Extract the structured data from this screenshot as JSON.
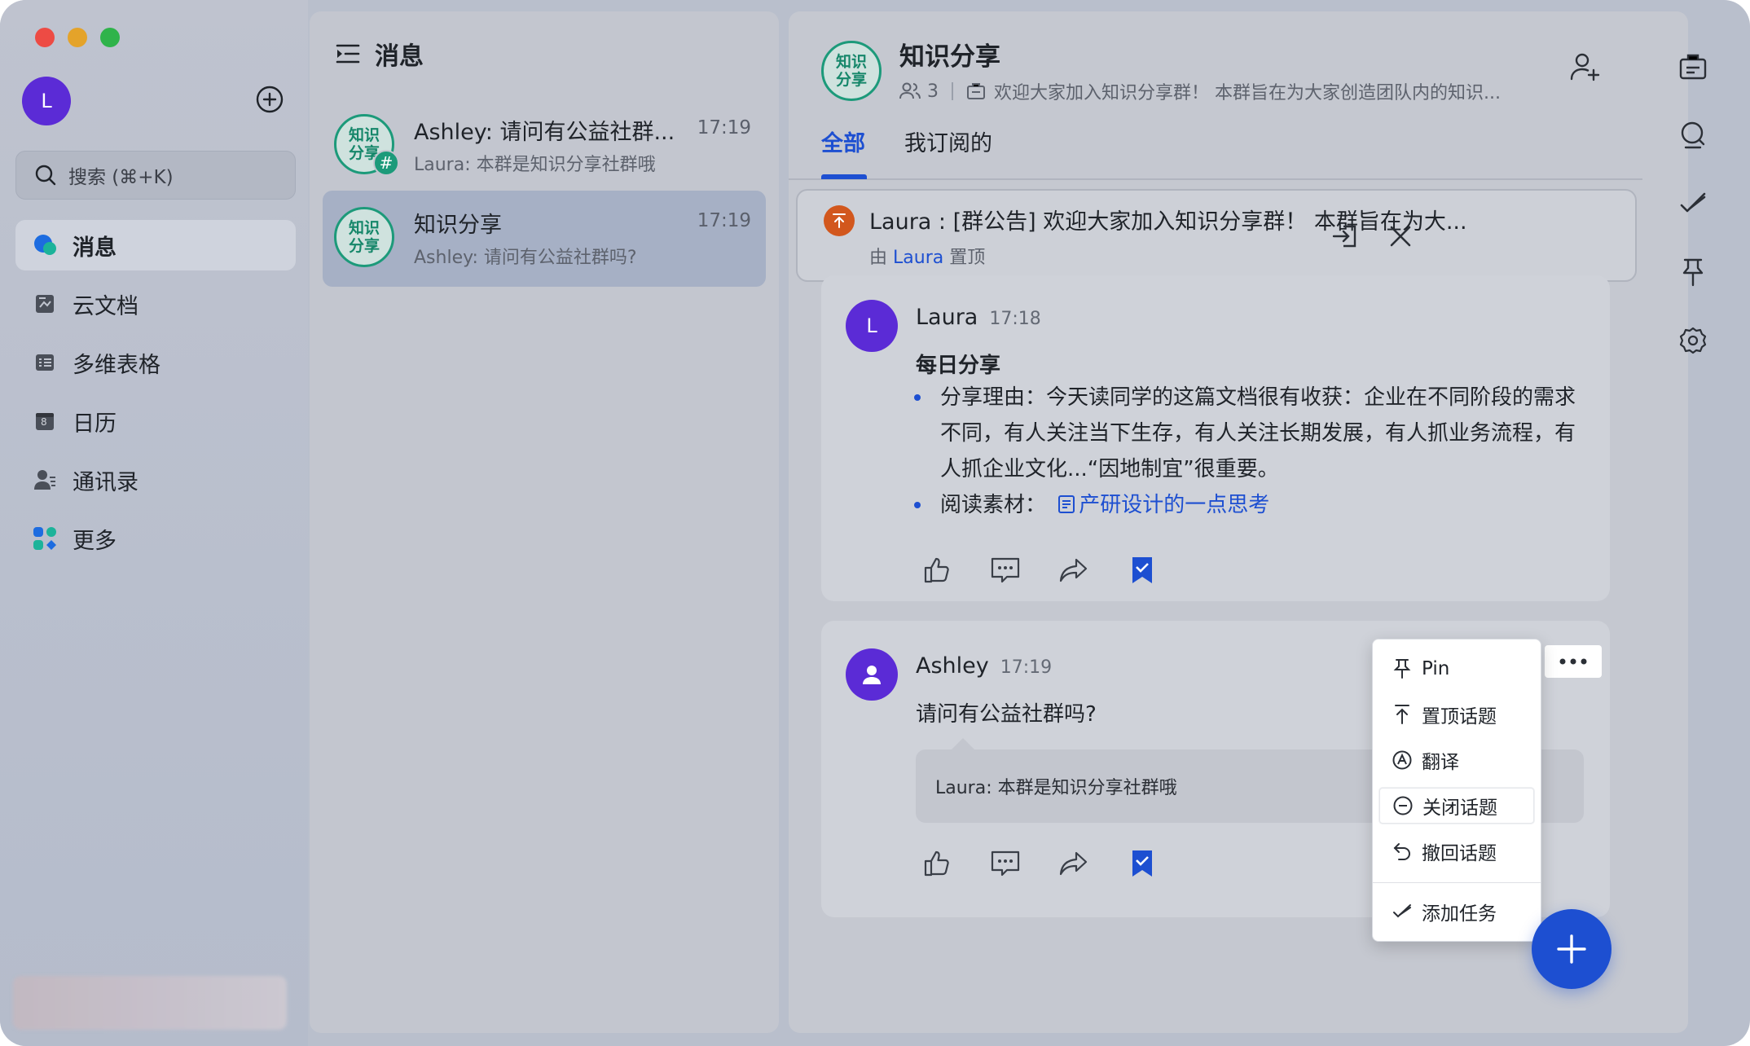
{
  "sidebar": {
    "avatar_letter": "L",
    "search_placeholder": "搜索 (⌘+K)",
    "items": [
      {
        "label": "消息",
        "icon": "chat-bubble-icon"
      },
      {
        "label": "云文档",
        "icon": "doc-icon"
      },
      {
        "label": "多维表格",
        "icon": "table-icon"
      },
      {
        "label": "日历",
        "icon": "calendar-icon"
      },
      {
        "label": "通讯录",
        "icon": "contacts-icon"
      },
      {
        "label": "更多",
        "icon": "apps-icon"
      }
    ],
    "calendar_day": "8"
  },
  "message_list": {
    "title": "消息",
    "chats": [
      {
        "name": "Ashley: 请问有公益社群...",
        "time": "17:19",
        "preview": "Laura: 本群是知识分享社群哦",
        "avatar_text": "知识\n分享",
        "badge": "#"
      },
      {
        "name": "知识分享",
        "time": "17:19",
        "preview": "Ashley: 请问有公益社群吗?",
        "avatar_text": "知识\n分享"
      }
    ]
  },
  "chat": {
    "avatar_text": "知识\n分享",
    "title": "知识分享",
    "member_count": "3",
    "description": "欢迎大家加入知识分享群！ 本群旨在为大家创造团队内的知识...",
    "tabs": [
      "全部",
      "我订阅的"
    ],
    "pinned": {
      "text": "Laura : [群公告] 欢迎大家加入知识分享群！ 本群旨在为大...",
      "by_prefix": "由",
      "by_name": "Laura",
      "by_suffix": "置顶"
    },
    "messages": [
      {
        "avatar_letter": "L",
        "sender": "Laura",
        "time": "17:18",
        "title": "每日分享",
        "bullet1": "分享理由：今天读同学的这篇文档很有收获：企业在不同阶段的需求不同，有人关注当下生存，有人关注长期发展，有人抓业务流程，有人抓企业文化...“因地制宜”很重要。",
        "bullet2_label": "阅读素材：",
        "bullet2_link": "产研设计的一点思考"
      },
      {
        "sender": "Ashley",
        "time": "17:19",
        "text": "请问有公益社群吗?",
        "reply": "Laura: 本群是知识分享社群哦"
      }
    ]
  },
  "context_menu": {
    "items": [
      {
        "label": "Pin",
        "icon": "pin-icon"
      },
      {
        "label": "置顶话题",
        "icon": "top-arrow-icon"
      },
      {
        "label": "翻译",
        "icon": "translate-icon"
      },
      {
        "label": "关闭话题",
        "icon": "minus-circle-icon"
      },
      {
        "label": "撤回话题",
        "icon": "undo-icon"
      },
      {
        "label": "添加任务",
        "icon": "task-check-icon"
      }
    ]
  },
  "colors": {
    "accent": "#1d4fd1",
    "group_green": "#1c9a7a",
    "avatar_purple": "#5b2bd6",
    "pin_orange": "#d2571d"
  }
}
